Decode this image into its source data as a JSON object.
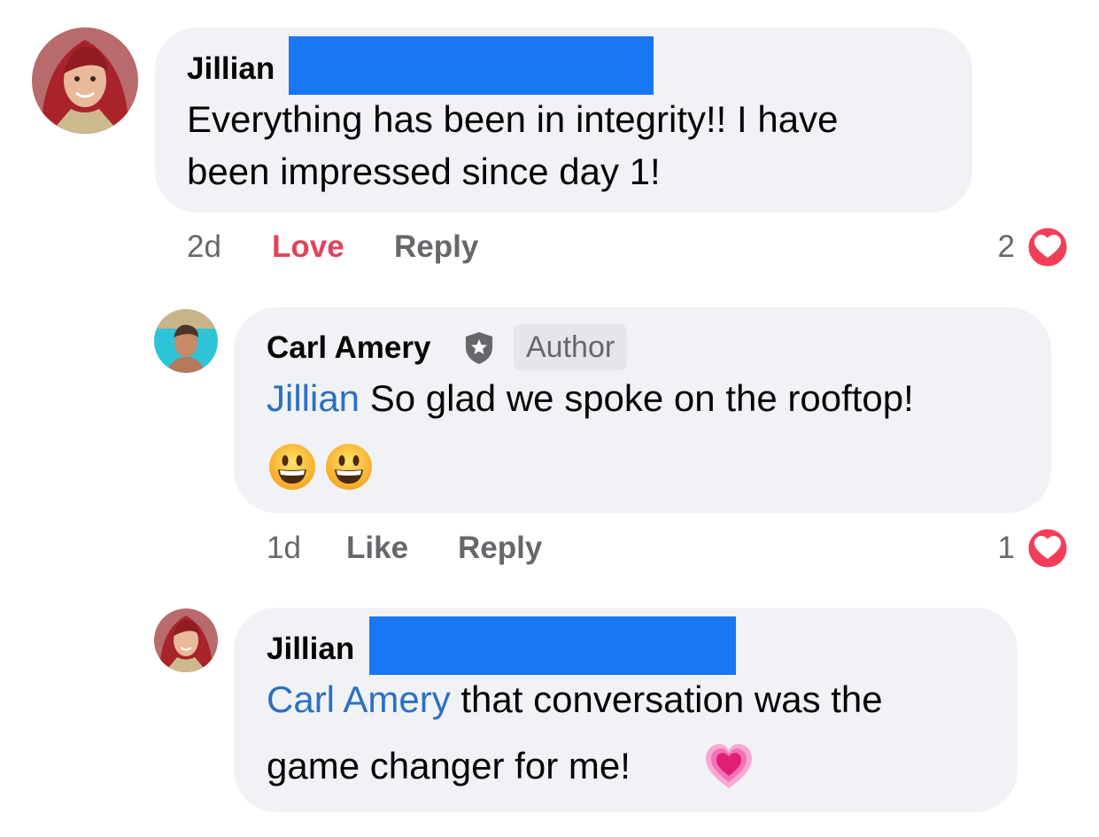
{
  "comments": [
    {
      "author": "Jillian",
      "lines": [
        "Everything has been in integrity!! I have",
        "been impressed since day 1!"
      ],
      "time": "2d",
      "reaction_label": "Love",
      "reply_label": "Reply",
      "reaction_count": "2"
    },
    {
      "author": "Carl Amery",
      "badge": "Author",
      "mention": "Jillian",
      "text": " So glad we spoke on the rooftop!",
      "emojis": [
        "grinning-face",
        "grinning-face"
      ],
      "time": "1d",
      "like_label": "Like",
      "reply_label": "Reply",
      "reaction_count": "1"
    },
    {
      "author": "Jillian",
      "mention": "Carl Amery",
      "line1_rest": " that conversation was the",
      "line2": "game changer for me!",
      "emoji": "growing-heart"
    }
  ],
  "colors": {
    "bubble": "#f0f2f5",
    "redaction": "#1877f2",
    "mention": "#2d6fc4",
    "love": "#e0435c",
    "meta": "#65676b"
  }
}
